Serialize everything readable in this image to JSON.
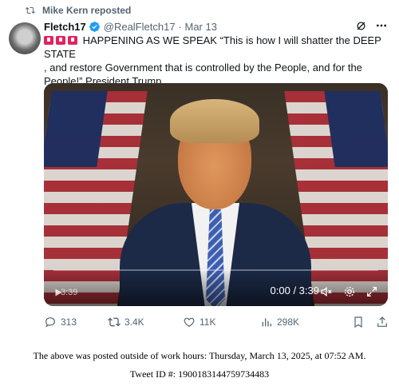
{
  "repost": {
    "label": "Mike Kern reposted"
  },
  "author": {
    "name": "Fletch17",
    "handle": "@RealFletch17",
    "date": "· Mar 13"
  },
  "tweet": {
    "text_line1": "HAPPENING AS WE SPEAK “This is how I will shatter the DEEP STATE",
    "text_line2": ", and restore Government that is controlled by the People, and for the",
    "text_line3": "People!” President Trump"
  },
  "video": {
    "remaining": "3:39",
    "time": "0:00 / 3:39",
    "progress": 0
  },
  "actions": {
    "replies": "313",
    "reposts": "3.4K",
    "likes": "11K",
    "views": "298K"
  },
  "footer": {
    "line1": "The above was posted outside of work hours: Thursday, March 13, 2025, at 07:52 AM.",
    "line2": "Tweet ID #: 1900183144759734483"
  },
  "colors": {
    "verified": "#1d9bf0",
    "muted": "#536471",
    "siren": "#e0245e"
  }
}
